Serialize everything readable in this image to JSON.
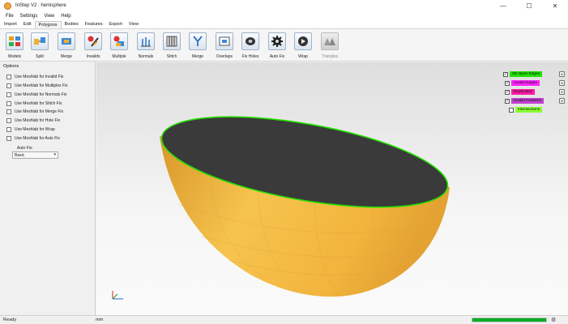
{
  "window": {
    "title": "InStep V2 : hemisphere",
    "controls": {
      "minimize": "—",
      "maximize": "☐",
      "close": "✕"
    }
  },
  "menu": [
    "File",
    "Settings",
    "View",
    "Help"
  ],
  "tabs": [
    {
      "label": "Import",
      "active": false
    },
    {
      "label": "Edit",
      "active": false
    },
    {
      "label": "Polygons",
      "active": true
    },
    {
      "label": "Bodies",
      "active": false
    },
    {
      "label": "Features",
      "active": false
    },
    {
      "label": "Export",
      "active": false
    },
    {
      "label": "View",
      "active": false
    }
  ],
  "ribbon": [
    {
      "label": "Models",
      "icon": "models-icon",
      "enabled": true
    },
    {
      "label": "Split",
      "icon": "split-icon",
      "enabled": true
    },
    {
      "label": "Merge",
      "icon": "merge-icon",
      "enabled": true
    },
    {
      "label": "Invalids",
      "icon": "invalids-icon",
      "enabled": true
    },
    {
      "label": "Multiple",
      "icon": "multiple-icon",
      "enabled": true
    },
    {
      "label": "Normals",
      "icon": "normals-icon",
      "enabled": true
    },
    {
      "label": "Stitch",
      "icon": "stitch-icon",
      "enabled": true
    },
    {
      "label": "Merge",
      "icon": "merge-vertices-icon",
      "enabled": true
    },
    {
      "label": "Overlaps",
      "icon": "overlaps-icon",
      "enabled": true
    },
    {
      "label": "Fix Holes",
      "icon": "fix-holes-icon",
      "enabled": true
    },
    {
      "label": "Auto Fix",
      "icon": "auto-fix-gear-icon",
      "enabled": true
    },
    {
      "label": "Wrap",
      "icon": "wrap-icon",
      "enabled": true
    },
    {
      "label": "Triangles",
      "icon": "triangles-icon",
      "enabled": false
    }
  ],
  "options": {
    "title": "Options",
    "checkboxes": [
      {
        "label": "Use Meshlab for Invalid Fix",
        "checked": false
      },
      {
        "label": "Use Meshlab for Multiplex Fix",
        "checked": false
      },
      {
        "label": "Use Meshlab for Normals Fix",
        "checked": false
      },
      {
        "label": "Use Meshlab for Stitch Fix",
        "checked": false
      },
      {
        "label": "Use Meshlab for Merge Fix",
        "checked": false
      },
      {
        "label": "Use Meshlab for Hole Fix",
        "checked": false
      },
      {
        "label": "Use Meshlab for Wrap",
        "checked": false
      },
      {
        "label": "Use Meshlab for Auto Fix",
        "checked": false
      }
    ],
    "auto_fix_label": "Auto Fix:",
    "auto_fix_value": "Basic"
  },
  "legend": [
    {
      "label": "3D Open Edges",
      "color": "#22e000",
      "checked": true
    },
    {
      "label": "Invalid Edges",
      "color": "#ff22ff",
      "checked": true
    },
    {
      "label": "Duplicated",
      "color": "#ff1aa6",
      "checked": true
    },
    {
      "label": "Invalid Features",
      "color": "#c040d0",
      "checked": true
    },
    {
      "label": "Intersections",
      "color": "#88ff33",
      "checked": false
    }
  ],
  "colors": {
    "mesh_outer": "#f2b43c",
    "mesh_inner": "#3a3a3a",
    "open_edge": "#22e000"
  },
  "status": {
    "text": "Ready",
    "units": "mm",
    "progress": 1.0
  }
}
